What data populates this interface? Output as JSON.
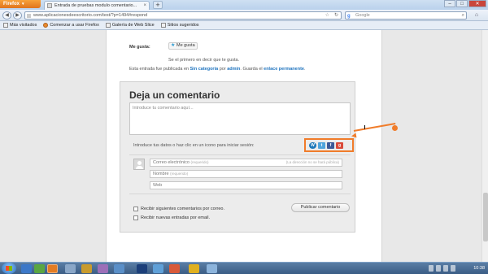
{
  "browser": {
    "menu_label": "Firefox",
    "tab_title": "Entrada de pruebas modulo comentario...",
    "tab_close": "×",
    "new_tab": "+",
    "url": "www.aplicacionesdeescritorio.com/test/?p=1494#respond",
    "search_engine": "Google",
    "search_placeholder": "Google"
  },
  "window_controls": {
    "minimize": "–",
    "maximize": "□",
    "close": "✕"
  },
  "bookmarks": [
    {
      "label": "Más visitados"
    },
    {
      "label": "Comenzar a usar Firefox"
    },
    {
      "label": "Galería de Web Slice"
    },
    {
      "label": "Sitios sugeridos"
    }
  ],
  "post": {
    "like_label": "Me gusta:",
    "like_button": "Me gusta",
    "first_like": "Se el primero en decir que te gusta.",
    "meta_prefix": "Esta entrada fue publicada en",
    "category": "Sin categoría",
    "meta_by": "por",
    "author": "admin",
    "meta_save": ". Guarda el",
    "permalink": "enlace permanente",
    "meta_end": "."
  },
  "comment_form": {
    "title": "Deja un comentario",
    "textarea_placeholder": "Introduce tu comentario aquí...",
    "login_hint": "Introduce tus datos o haz clic en un icono para iniciar sesión:",
    "email_label": "Correo electrónico",
    "email_required": "(requerido)",
    "email_note": "(La dirección no se hará pública)",
    "name_label": "Nombre",
    "name_required": "(requerido)",
    "web_label": "Web",
    "subscribe_comments": "Recibir siguientes comentarios por correo.",
    "subscribe_posts": "Recibir nuevas entradas por email.",
    "publish_button": "Publicar comentario"
  },
  "social_icons": [
    "wordpress-icon",
    "twitter-icon",
    "facebook-icon",
    "googleplus-icon"
  ],
  "annotation": {
    "color": "#f07c2a"
  },
  "taskbar": {
    "clock": "10:38"
  }
}
